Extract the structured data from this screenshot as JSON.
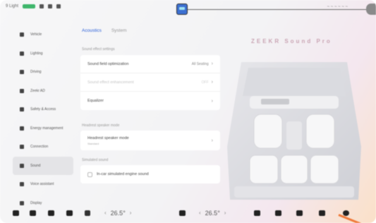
{
  "status_bar": {
    "left": [
      "9 Light",
      "",
      "",
      ""
    ],
    "right_text": "~ ~ ~ ~ ~ ~"
  },
  "sidebar": {
    "items": [
      {
        "label": "Vehicle",
        "icon": "car-icon"
      },
      {
        "label": "Lighting",
        "icon": "light-icon"
      },
      {
        "label": "Driving",
        "icon": "steering-icon"
      },
      {
        "label": "Zeekr AD",
        "icon": "assist-icon"
      },
      {
        "label": "Safety & Access",
        "icon": "shield-icon"
      },
      {
        "label": "Energy management",
        "icon": "energy-icon"
      },
      {
        "label": "Connection",
        "icon": "link-icon"
      },
      {
        "label": "Sound",
        "icon": "speaker-icon",
        "active": true
      },
      {
        "label": "Voice assistant",
        "icon": "mic-icon"
      },
      {
        "label": "Display",
        "icon": "display-icon"
      }
    ]
  },
  "tabs": [
    {
      "label": "Acoustics",
      "active": true
    },
    {
      "label": "System",
      "active": false
    }
  ],
  "sections": {
    "sound_effect_settings": "Sound effect settings",
    "headrest_speaker_mode": "Headrest speaker mode",
    "simulated_sound": "Simulated sound"
  },
  "rows": {
    "sound_field": {
      "label": "Sound field optimization",
      "value": "All Seating"
    },
    "sound_effect_enhancement": {
      "label": "Sound effect enhancement",
      "value": "OFF"
    },
    "equalizer": {
      "label": "Equalizer"
    },
    "headrest": {
      "label": "Headrest speaker mode",
      "sub": "Standard"
    },
    "engine_sound": {
      "label": "In-car simulated engine sound"
    }
  },
  "brand": "ZEEKR Sound Pro",
  "dock": {
    "temp_left": "26.5°",
    "temp_right": "26.5°",
    "arrow_left": "‹",
    "arrow_right": "›"
  },
  "colors": {
    "accent_tab": "#2a5fd8",
    "active_item_bg": "#e4e4e7",
    "battery": "#3fb66b"
  }
}
